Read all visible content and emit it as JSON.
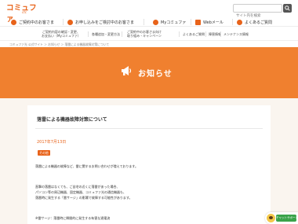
{
  "header": {
    "logo_main": "コミュファ",
    "logo_sub": "ctc",
    "search_placeholder": "サイト内を検索"
  },
  "nav": {
    "items": [
      {
        "label": "ご契約中のお客さま",
        "icon_color": "#e8631a"
      },
      {
        "label": "お申し込みをご検討中のお客さま",
        "icon_color": "#e8631a"
      },
      {
        "label": "Myコミュファ",
        "icon_color": "#e8631a"
      },
      {
        "label": "Webメール",
        "icon_color": "#e8631a"
      },
      {
        "label": "よくあるご質問",
        "icon_color": "#e8631a"
      }
    ]
  },
  "subnav": {
    "items": [
      {
        "line1": "ご契約内容の確認・変更、",
        "line2": "お支払い（Myコミュファ）"
      },
      {
        "line1": "各種追加・変更方法",
        "line2": ""
      },
      {
        "line1": "ご契約中のお客さま向け",
        "line2": "取り組み・キャンペーン"
      },
      {
        "line1": "よくあるご質問",
        "line2": ""
      },
      {
        "line1": "障害情報",
        "line2": ""
      },
      {
        "line1": "メンテナンス情報",
        "line2": ""
      }
    ]
  },
  "breadcrumb": "コミュファ光 公式サイト ＞ お知らせ ＞ 落雷による機器故障対策について",
  "banner": {
    "title": "お知らせ",
    "bg_color": "#f0802f"
  },
  "article": {
    "title": "落雷による機器故障対策について",
    "date": "2017年7月13日",
    "tag": "その他",
    "paragraphs": [
      "落雷による機器の故障など、雷に関するお問い合わせが増えております。",
      "",
      "直撃の落雷はなくても、ご自宅の近くに落雷があった場合、",
      "パソコン等の周辺機器、固定機器、コミュファ光の通信機器も、",
      "落雷時に発生する「雷サージ」の影響で故障する可能性があります。",
      "",
      "※雷サージ：落雷時に瞬間的に発生する有害な過電流"
    ]
  },
  "chat": {
    "label": "チャットサポート"
  }
}
